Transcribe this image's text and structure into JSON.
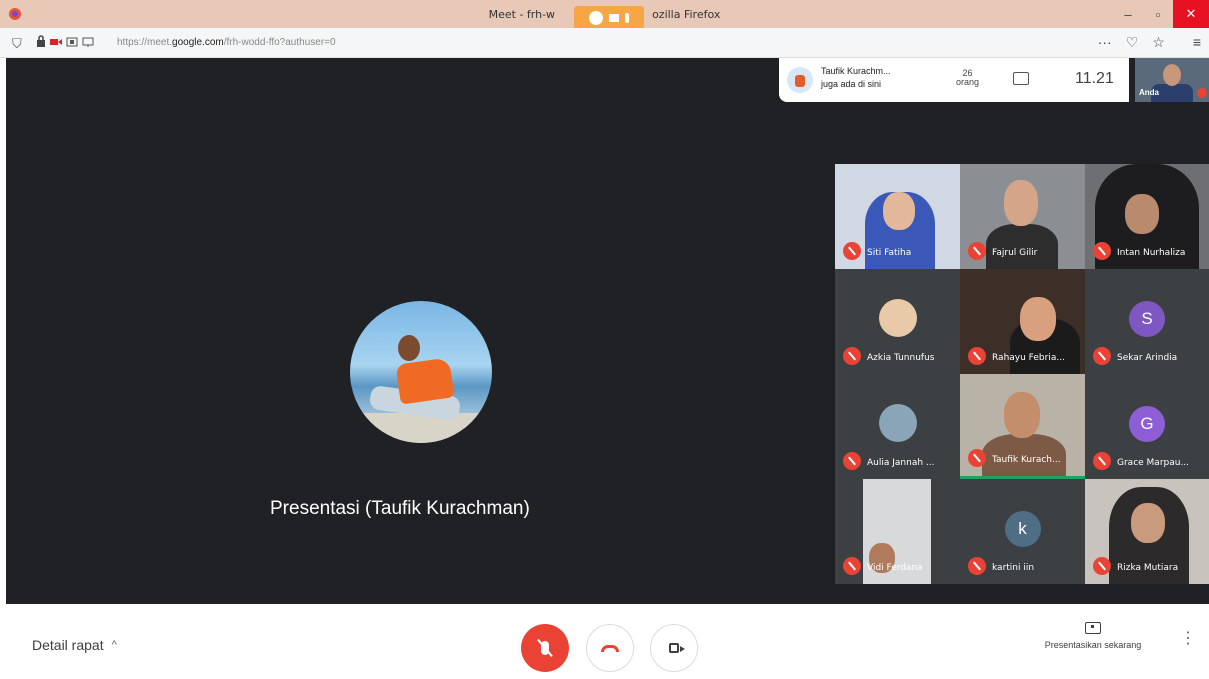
{
  "browser": {
    "window_title": "Meet - frh-w",
    "window_title_suffix": "ozilla Firefox",
    "url_prefix": "https://meet.",
    "url_domain": "google.com",
    "url_path": "/frh-wodd-ffo?authuser=0",
    "minimize_glyph": "–",
    "maximize_glyph": "▫",
    "close_glyph": "✕",
    "menu_dots_glyph": "···",
    "pocket_glyph": "♡",
    "star_glyph": "☆",
    "hamburger_glyph": "≡",
    "shield_glyph": "⛉"
  },
  "meeting": {
    "presenter_name_line": "Taufik Kurachm...",
    "presenter_sub_line": "juga ada di sini",
    "participant_count": "26",
    "participant_count_label": "orang",
    "clock": "11.21",
    "self_label": "Anda",
    "main_label": "Presentasi (Taufik Kurachman)"
  },
  "participants": [
    {
      "name": "Siti Fatiha"
    },
    {
      "name": "Fajrul Gilir"
    },
    {
      "name": "Intan Nurhaliza"
    },
    {
      "name": "Azkia Tunnufus",
      "avatar": "photo"
    },
    {
      "name": "Rahayu Febria..."
    },
    {
      "name": "Sekar Arindia",
      "initial": "S",
      "color": "#7e57c2"
    },
    {
      "name": "Aulia Jannah ...",
      "avatar": "photo"
    },
    {
      "name": "Taufik Kurach..."
    },
    {
      "name": "Grace Marpau...",
      "initial": "G",
      "color": "#8e5ed6"
    },
    {
      "name": "Vidi Ferdana"
    },
    {
      "name": "kartini iin",
      "initial": "k",
      "color": "#4f6e86"
    },
    {
      "name": "Rizka Mutiara"
    }
  ],
  "controls": {
    "meeting_details": "Detail rapat",
    "chevron_glyph": "^",
    "present_now": "Presentasikan sekarang",
    "more_glyph": "⋮"
  },
  "colors": {
    "accent_red": "#ea4335",
    "stage_bg": "#202124",
    "active_speaker": "#1ea362"
  }
}
